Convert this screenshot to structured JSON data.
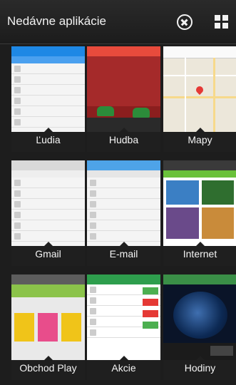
{
  "header": {
    "title": "Nedávne aplikácie"
  },
  "apps": [
    {
      "label": "Ľudia"
    },
    {
      "label": "Hudba"
    },
    {
      "label": "Mapy"
    },
    {
      "label": "Gmail"
    },
    {
      "label": "E-mail"
    },
    {
      "label": "Internet"
    },
    {
      "label": "Obchod Play"
    },
    {
      "label": "Akcie"
    },
    {
      "label": "Hodiny"
    }
  ],
  "colors": {
    "background": "#1d1d1d",
    "people_accent": "#1e88e5",
    "music_accent": "#e84b3c",
    "gmail_accent": "#d9d9d9",
    "email_accent": "#4ea3e8",
    "internet_accent": "#6ac13a",
    "play_accent": "#5d5d5d",
    "stocks_accent": "#2e9e4d",
    "clock_accent": "#3a8f47"
  }
}
